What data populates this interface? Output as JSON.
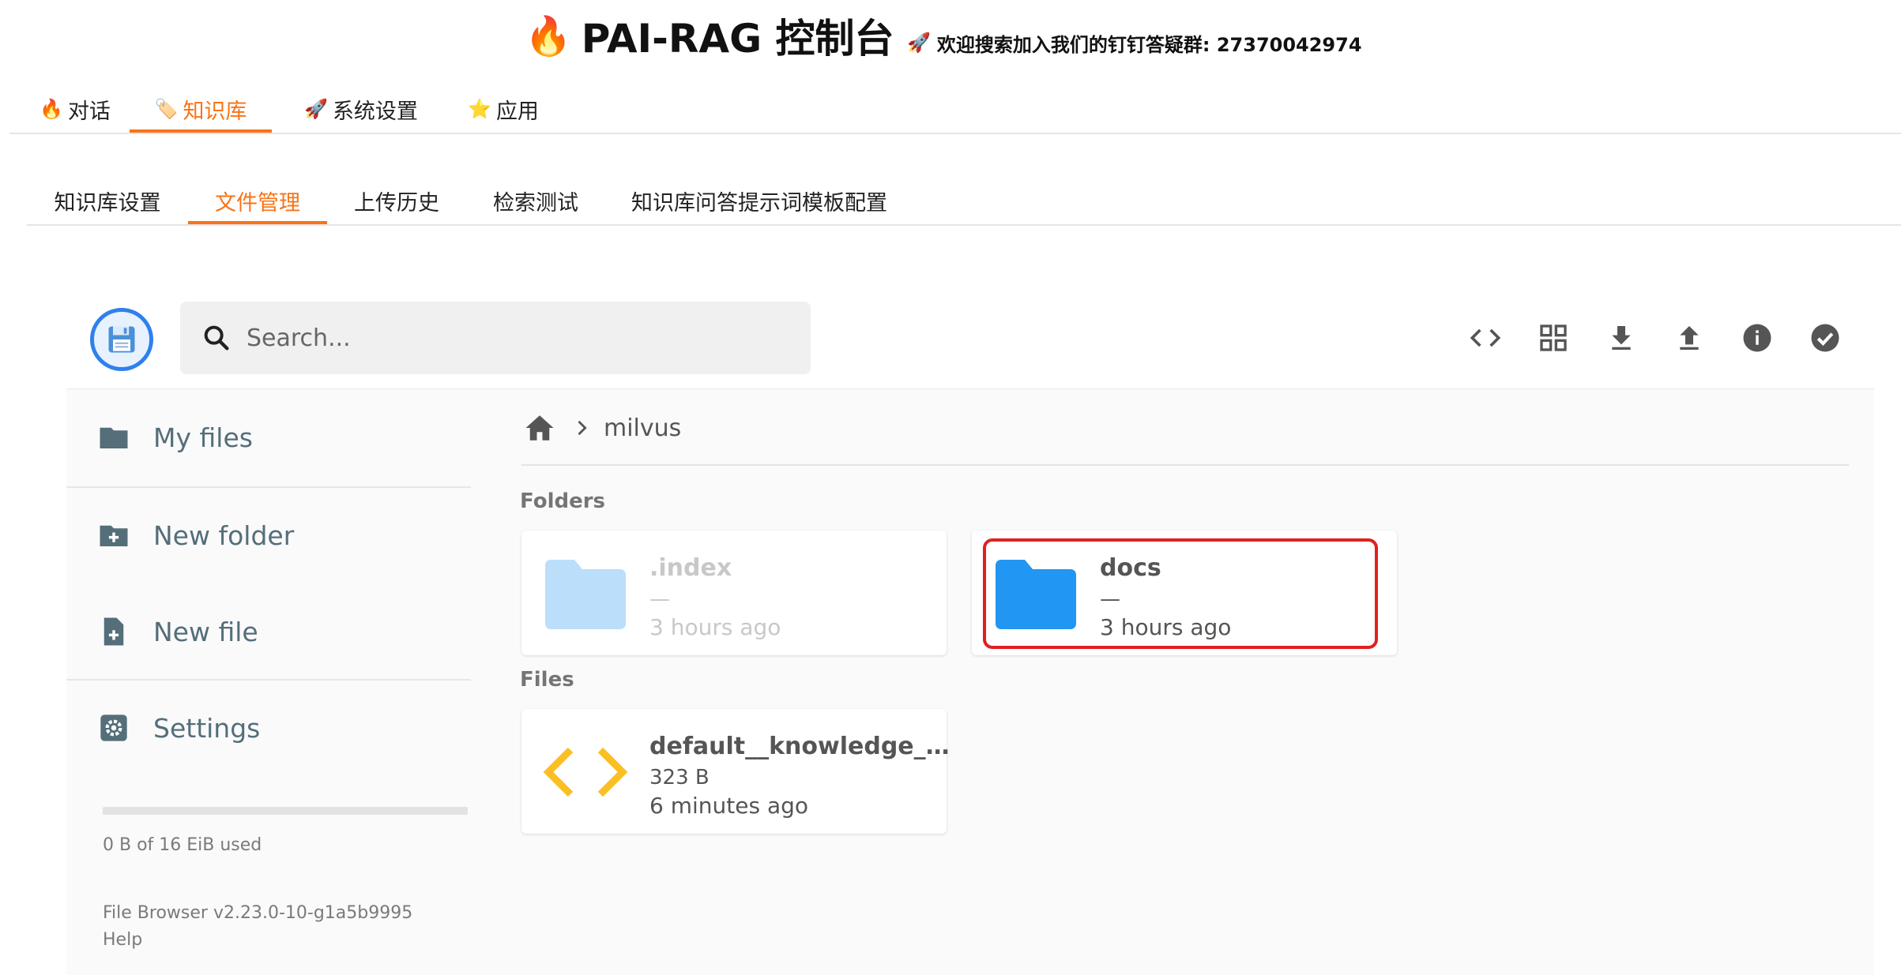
{
  "header": {
    "title": "PAI-RAG 控制台",
    "notice": "欢迎搜索加入我们的钉钉答疑群: 27370042974"
  },
  "top_tabs": [
    {
      "label": "对话",
      "icon": "fire-icon"
    },
    {
      "label": "知识库",
      "icon": "label-icon",
      "active": true
    },
    {
      "label": "系统设置",
      "icon": "rocket-icon"
    },
    {
      "label": "应用",
      "icon": "star-icon"
    }
  ],
  "sub_tabs": [
    {
      "label": "知识库设置"
    },
    {
      "label": "文件管理",
      "active": true
    },
    {
      "label": "上传历史"
    },
    {
      "label": "检索测试"
    },
    {
      "label": "知识库问答提示词模板配置"
    }
  ],
  "filebrowser": {
    "search_placeholder": "Search...",
    "toolbar": [
      "code-icon",
      "grid-view-icon",
      "download-icon",
      "upload-icon",
      "info-icon",
      "check-circle-icon"
    ],
    "sidebar": {
      "my_files": "My files",
      "new_folder": "New folder",
      "new_file": "New file",
      "settings": "Settings",
      "storage": "0 B of 16 EiB used",
      "storage_fraction": 0,
      "version": "File Browser v2.23.0-10-g1a5b9995",
      "help": "Help"
    },
    "breadcrumb": {
      "folder": "milvus"
    },
    "folders_label": "Folders",
    "files_label": "Files",
    "folders": [
      {
        "name": ".index",
        "size": "—",
        "time": "3 hours ago",
        "dimmed": true
      },
      {
        "name": "docs",
        "size": "—",
        "time": "3 hours ago",
        "highlighted": true
      }
    ],
    "files": [
      {
        "name": "default__knowledge__d...",
        "size": "323 B",
        "time": "6 minutes ago"
      }
    ]
  },
  "colors": {
    "accent": "#f97316",
    "folder_blue": "#2196f3",
    "highlight_red": "#e02020",
    "code_yellow": "#fbbf24"
  }
}
